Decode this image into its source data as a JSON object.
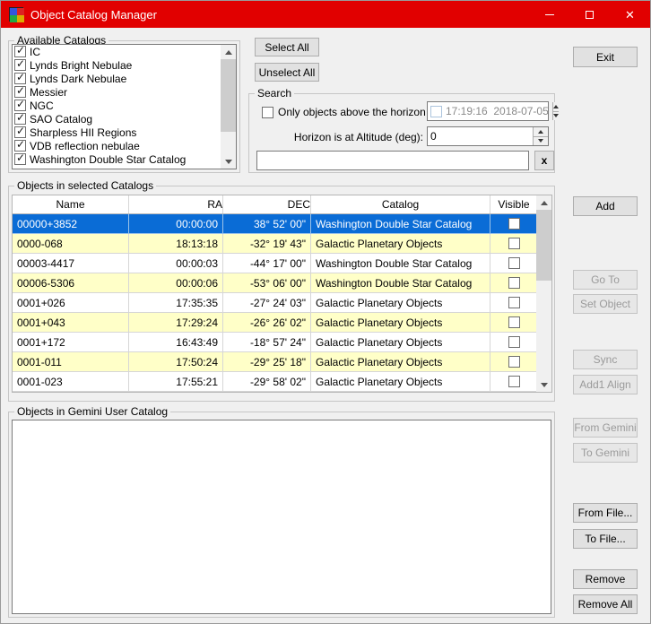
{
  "window": {
    "title": "Object Catalog Manager"
  },
  "colors": {
    "titlebar": "#e10000",
    "selected": "#0a6cd6",
    "rowalt": "#ffffc8"
  },
  "available_catalogs": {
    "label": "Available Catalogs",
    "items": [
      {
        "label": "IC",
        "checked": true
      },
      {
        "label": "Lynds Bright Nebulae",
        "checked": true
      },
      {
        "label": "Lynds Dark Nebulae",
        "checked": true
      },
      {
        "label": "Messier",
        "checked": true
      },
      {
        "label": "NGC",
        "checked": true
      },
      {
        "label": "SAO Catalog",
        "checked": true
      },
      {
        "label": "Sharpless HII Regions",
        "checked": true
      },
      {
        "label": "VDB reflection nebulae",
        "checked": true
      },
      {
        "label": "Washington Double Star Catalog",
        "checked": true
      }
    ]
  },
  "top_buttons": {
    "select_all": "Select All",
    "unselect_all": "Unselect All",
    "exit": "Exit"
  },
  "search": {
    "label": "Search",
    "above_horizon_label": "Only objects above the horizon",
    "above_horizon_checked": false,
    "datetime_value": "17:19:16  2018-07-05",
    "datetime_checked": false,
    "horizon_label": "Horizon is at Altitude (deg):",
    "horizon_value": "0",
    "search_value": "",
    "clear_label": "x"
  },
  "objects_table": {
    "label": "Objects in selected Catalogs",
    "columns": [
      "Name",
      "RA",
      "DEC",
      "Catalog",
      "Visible"
    ],
    "rows": [
      {
        "name": "00000+3852",
        "ra": "00:00:00",
        "dec": "38° 52' 00\"",
        "catalog": "Washington Double Star Catalog",
        "visible": false,
        "selected": true
      },
      {
        "name": "0000-068",
        "ra": "18:13:18",
        "dec": "-32° 19' 43\"",
        "catalog": "Galactic Planetary Objects",
        "visible": false,
        "selected": false
      },
      {
        "name": "00003-4417",
        "ra": "00:00:03",
        "dec": "-44° 17' 00\"",
        "catalog": "Washington Double Star Catalog",
        "visible": false,
        "selected": false
      },
      {
        "name": "00006-5306",
        "ra": "00:00:06",
        "dec": "-53° 06' 00\"",
        "catalog": "Washington Double Star Catalog",
        "visible": false,
        "selected": false
      },
      {
        "name": "0001+026",
        "ra": "17:35:35",
        "dec": "-27° 24' 03\"",
        "catalog": "Galactic Planetary Objects",
        "visible": false,
        "selected": false
      },
      {
        "name": "0001+043",
        "ra": "17:29:24",
        "dec": "-26° 26' 02\"",
        "catalog": "Galactic Planetary Objects",
        "visible": false,
        "selected": false
      },
      {
        "name": "0001+172",
        "ra": "16:43:49",
        "dec": "-18° 57' 24\"",
        "catalog": "Galactic Planetary Objects",
        "visible": false,
        "selected": false
      },
      {
        "name": "0001-011",
        "ra": "17:50:24",
        "dec": "-29° 25' 18\"",
        "catalog": "Galactic Planetary Objects",
        "visible": false,
        "selected": false
      },
      {
        "name": "0001-023",
        "ra": "17:55:21",
        "dec": "-29° 58' 02\"",
        "catalog": "Galactic Planetary Objects",
        "visible": false,
        "selected": false
      }
    ]
  },
  "user_catalog": {
    "label": "Objects in Gemini User Catalog"
  },
  "side_buttons": {
    "add": "Add",
    "go_to": "Go To",
    "set_object": "Set Object",
    "sync": "Sync",
    "add1_align": "Add1 Align",
    "from_gemini": "From Gemini",
    "to_gemini": "To Gemini",
    "from_file": "From File...",
    "to_file": "To File...",
    "remove": "Remove",
    "remove_all": "Remove All"
  }
}
